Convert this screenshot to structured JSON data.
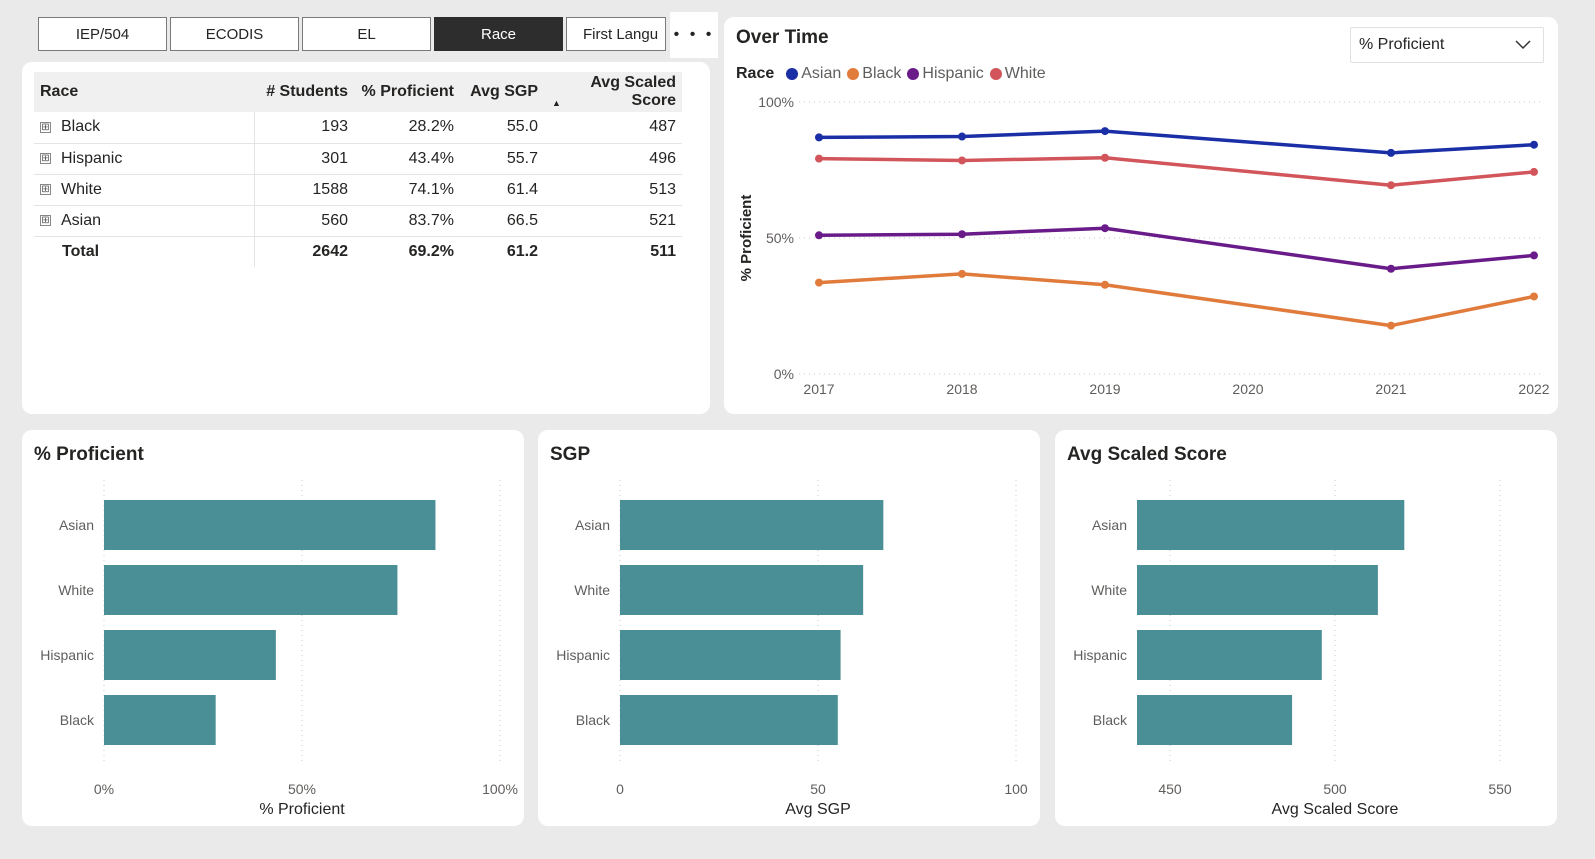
{
  "tabs": [
    {
      "label": "IEP/504",
      "active": false
    },
    {
      "label": "ECODIS",
      "active": false
    },
    {
      "label": "EL",
      "active": false
    },
    {
      "label": "Race",
      "active": true
    },
    {
      "label": "First Langu",
      "active": false
    }
  ],
  "more_label": "• • •",
  "table": {
    "headers": [
      "Race",
      "# Students",
      "% Proficient",
      "Avg SGP",
      "Avg Scaled Score"
    ],
    "sort_indicator": "▲",
    "expand_glyph": "⊞",
    "rows": [
      {
        "race": "Black",
        "students": "193",
        "proficient": "28.2%",
        "sgp": "55.0",
        "scaled": "487"
      },
      {
        "race": "Hispanic",
        "students": "301",
        "proficient": "43.4%",
        "sgp": "55.7",
        "scaled": "496"
      },
      {
        "race": "White",
        "students": "1588",
        "proficient": "74.1%",
        "sgp": "61.4",
        "scaled": "513"
      },
      {
        "race": "Asian",
        "students": "560",
        "proficient": "83.7%",
        "sgp": "66.5",
        "scaled": "521"
      }
    ],
    "total": {
      "race": "Total",
      "students": "2642",
      "proficient": "69.2%",
      "sgp": "61.2",
      "scaled": "511"
    }
  },
  "over_time": {
    "title": "Over Time",
    "dropdown_value": "% Proficient",
    "legend_title": "Race"
  },
  "colors": {
    "Asian": "#1a2ea6",
    "Black": "#e07b3c",
    "Hispanic": "#6a1b8a",
    "White": "#d1555a",
    "bar": "#4a8f95",
    "grid": "#c8c8c8",
    "tab_active": "#2d2d2d"
  },
  "chart_data": [
    {
      "type": "line",
      "title": "Over Time",
      "xlabel": "",
      "ylabel": "% Proficient",
      "x": [
        "2017",
        "2018",
        "2019",
        "2020",
        "2021",
        "2022"
      ],
      "ylim": [
        0,
        100
      ],
      "yticks": [
        "0%",
        "50%",
        "100%"
      ],
      "legend_title": "Race",
      "legend_position": "top-left",
      "series": [
        {
          "name": "Asian",
          "values": [
            87,
            87.3,
            89.3,
            null,
            81.3,
            84.3
          ]
        },
        {
          "name": "Black",
          "values": [
            33.6,
            36.8,
            32.8,
            null,
            17.8,
            28.5
          ]
        },
        {
          "name": "Hispanic",
          "values": [
            51,
            51.4,
            53.6,
            null,
            38.7,
            43.6
          ]
        },
        {
          "name": "White",
          "values": [
            79.2,
            78.5,
            79.5,
            null,
            69.4,
            74.3
          ]
        }
      ]
    },
    {
      "type": "bar",
      "orientation": "horizontal",
      "title": "% Proficient",
      "xlabel": "% Proficient",
      "categories": [
        "Asian",
        "White",
        "Hispanic",
        "Black"
      ],
      "values": [
        83.7,
        74.1,
        43.4,
        28.2
      ],
      "xlim": [
        0,
        100
      ],
      "xticks": [
        "0%",
        "50%",
        "100%"
      ],
      "tick_values": [
        0,
        50,
        100
      ]
    },
    {
      "type": "bar",
      "orientation": "horizontal",
      "title": "SGP",
      "xlabel": "Avg SGP",
      "categories": [
        "Asian",
        "White",
        "Hispanic",
        "Black"
      ],
      "values": [
        66.5,
        61.4,
        55.7,
        55.0
      ],
      "xlim": [
        0,
        100
      ],
      "xticks": [
        "0",
        "50",
        "100"
      ],
      "tick_values": [
        0,
        50,
        100
      ]
    },
    {
      "type": "bar",
      "orientation": "horizontal",
      "title": "Avg Scaled Score",
      "xlabel": "Avg Scaled Score",
      "categories": [
        "Asian",
        "White",
        "Hispanic",
        "Black"
      ],
      "values": [
        521,
        513,
        496,
        487
      ],
      "xlim": [
        440,
        560
      ],
      "xticks": [
        "450",
        "500",
        "550"
      ],
      "tick_values": [
        450,
        500,
        550
      ]
    }
  ]
}
